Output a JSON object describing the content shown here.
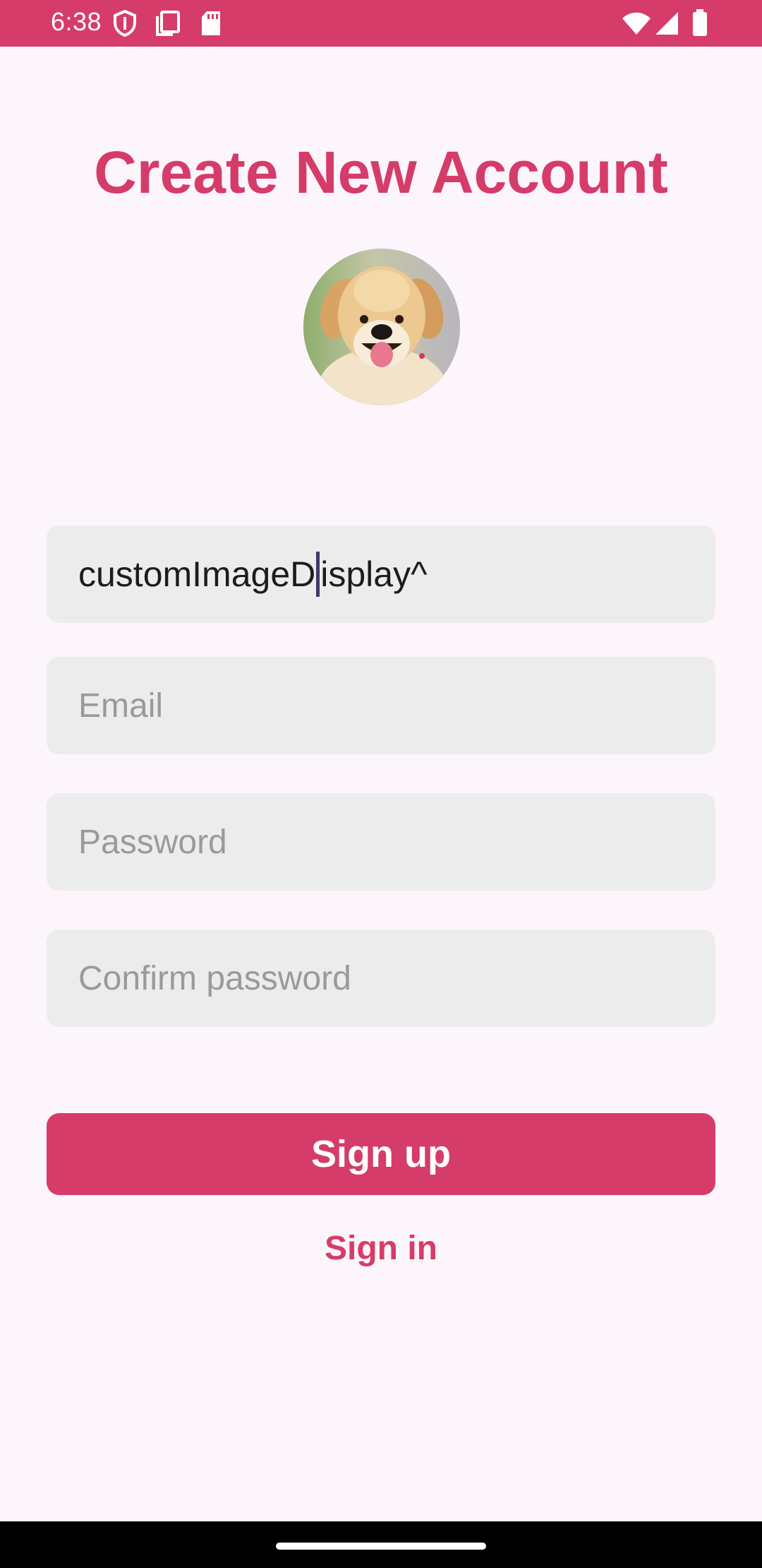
{
  "status_bar": {
    "time": "6:38",
    "icons": [
      "shield-icon",
      "clipboard-icon",
      "sd-card-icon",
      "wifi-icon",
      "cellular-icon",
      "battery-icon"
    ]
  },
  "header": {
    "title": "Create New Account"
  },
  "avatar": {
    "icon": "profile-photo-dog"
  },
  "form": {
    "username_value": "customImageDisplay^",
    "username_before_cursor": "customImageD",
    "username_after_cursor": "isplay^",
    "email_placeholder": "Email",
    "password_placeholder": "Password",
    "confirm_placeholder": "Confirm password"
  },
  "actions": {
    "signup_label": "Sign up",
    "signin_label": "Sign in"
  },
  "colors": {
    "accent": "#d63c69",
    "background": "#fdf5fc",
    "field": "#ececec"
  }
}
